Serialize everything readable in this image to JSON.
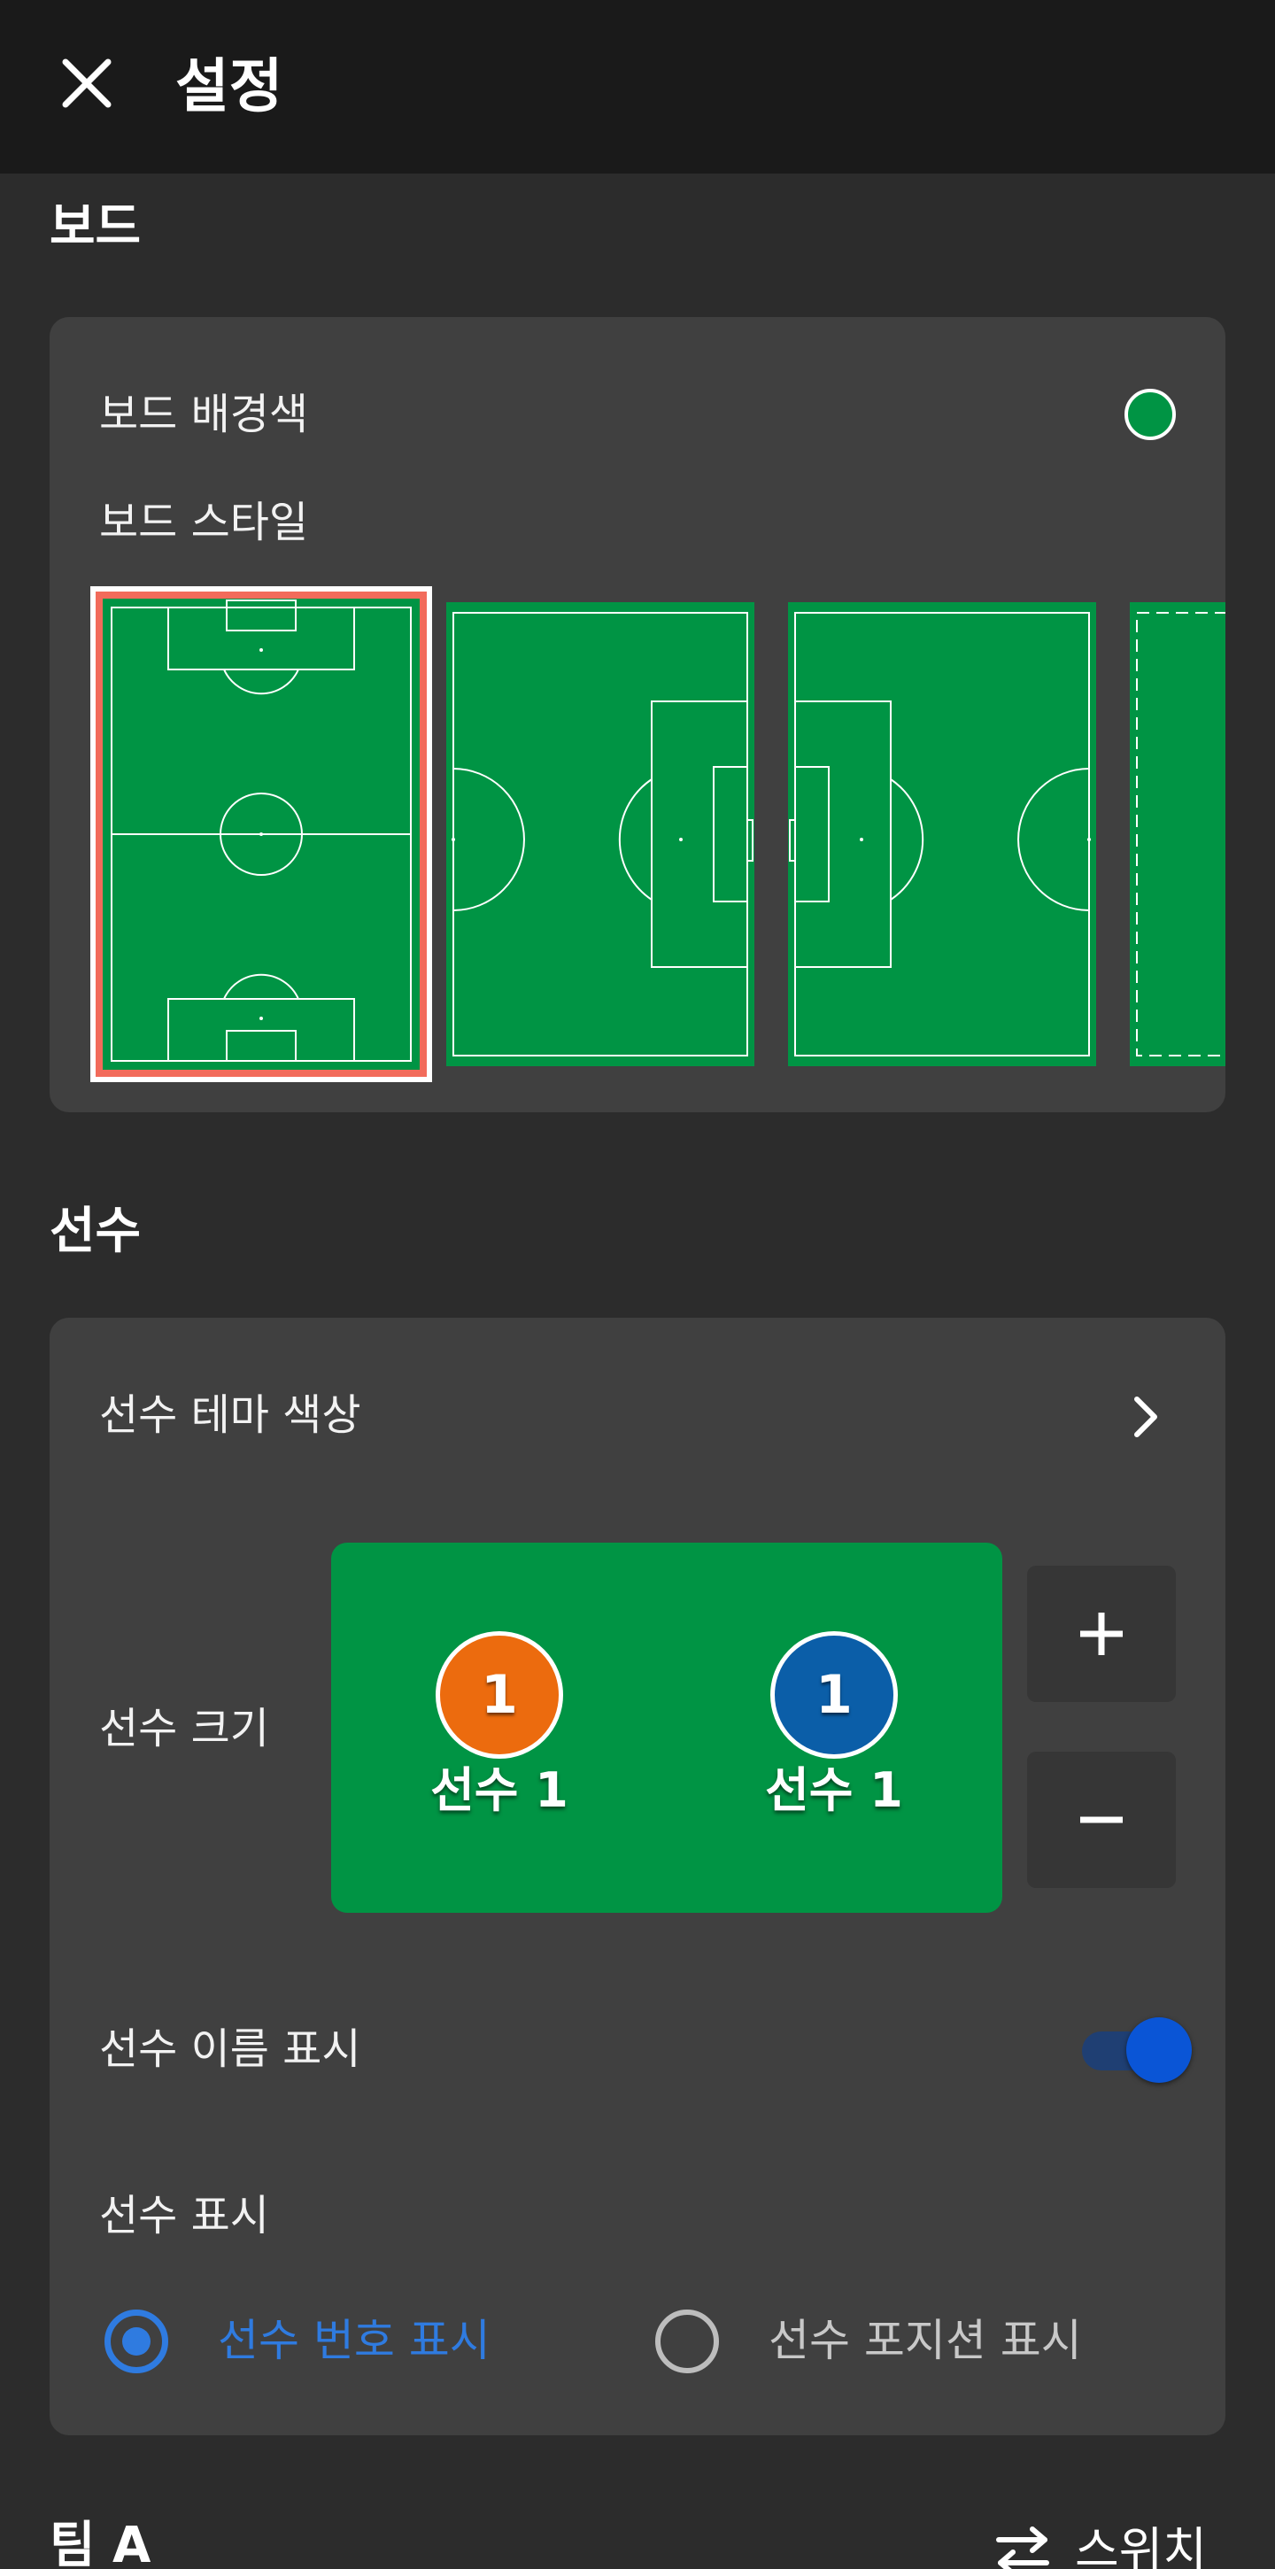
{
  "header": {
    "title": "설정",
    "close_icon": "close-icon"
  },
  "board_section": {
    "title": "보드",
    "bg_color_label": "보드 배경색",
    "bg_color": "#009444",
    "style_label": "보드 스타일",
    "styles": [
      "vertical-full",
      "horizontal-right",
      "horizontal-left",
      "dashed-partial"
    ],
    "selected_style_index": 0,
    "selected_border_color": "#f26b5b"
  },
  "players_section": {
    "title": "선수",
    "theme_color_label": "선수 테마 색상",
    "size_label": "선수 크기",
    "preview": {
      "players": [
        {
          "number": "1",
          "name": "선수 1",
          "color": "#ec6b0e"
        },
        {
          "number": "1",
          "name": "선수 1",
          "color": "#0b5ea8"
        }
      ]
    },
    "increase_icon": "plus-icon",
    "decrease_icon": "minus-icon",
    "show_name_label": "선수 이름 표시",
    "show_name_enabled": true,
    "display_label": "선수 표시",
    "display_options": [
      {
        "label": "선수 번호 표시",
        "selected": true
      },
      {
        "label": "선수 포지션 표시",
        "selected": false
      }
    ]
  },
  "team_section": {
    "title": "팀 A",
    "swap_label": "스위치",
    "swap_icon": "swap-icon"
  }
}
